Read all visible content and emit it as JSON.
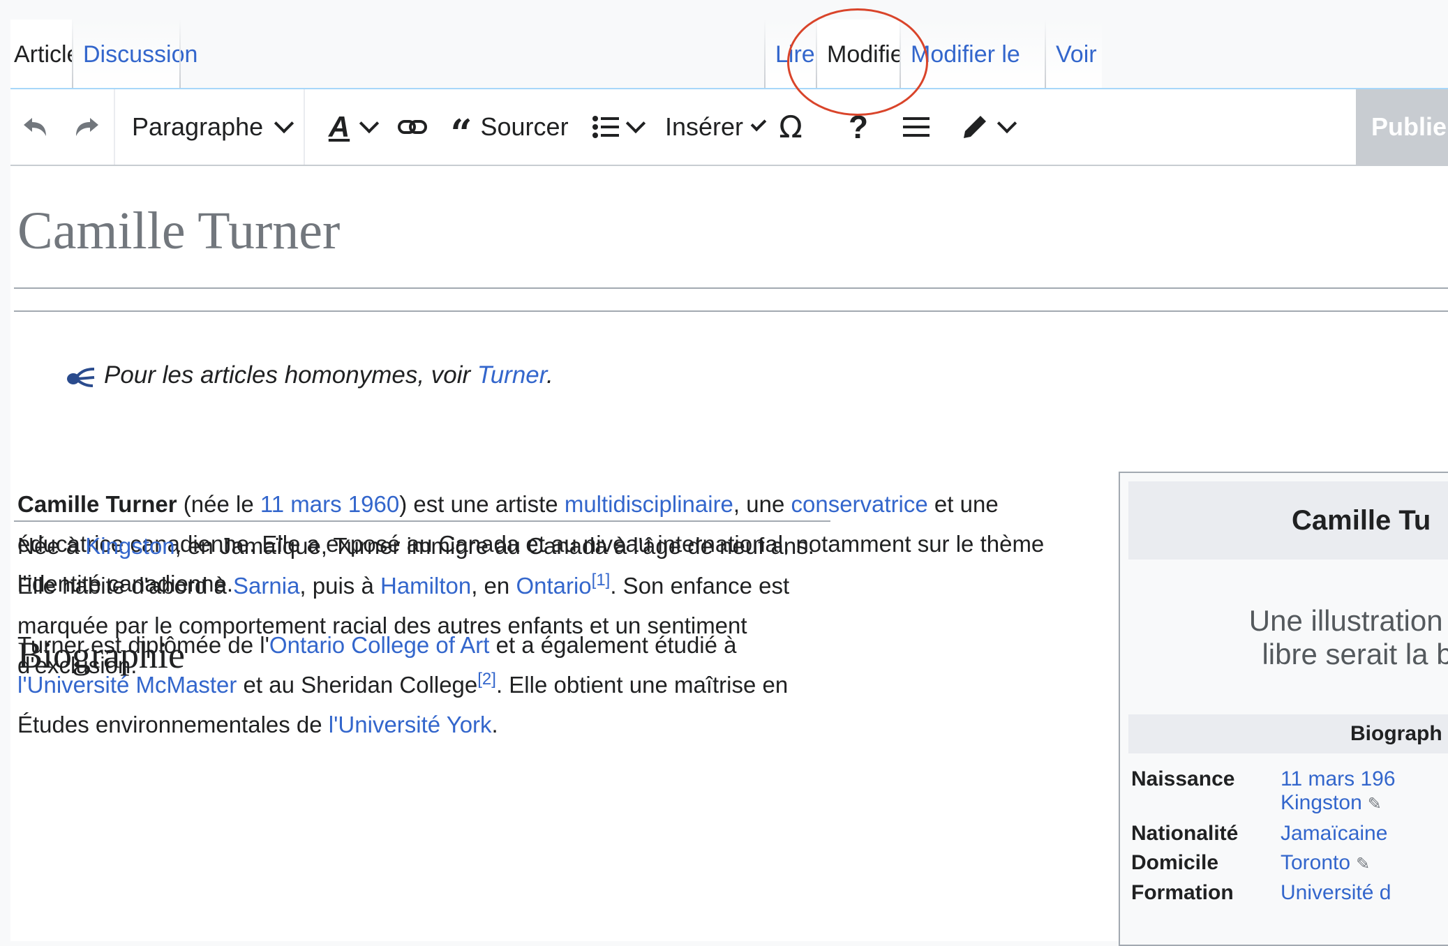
{
  "tabs": {
    "article": "Article",
    "discussion": "Discussion",
    "read": "Lire",
    "edit": "Modifier",
    "edit_source": "Modifier le code",
    "history": "Voir l"
  },
  "toolbar": {
    "paragraph": "Paragraphe",
    "cite": "Sourcer",
    "insert": "Insérer",
    "publish": "Publie"
  },
  "page": {
    "title": "Camille Turner",
    "hatnote": {
      "prefix": "Pour les articles homonymes, voir ",
      "link": "Turner",
      "suffix": "."
    },
    "intro": {
      "name": "Camille Turner",
      "t1": " (née le ",
      "date_link": "11 mars 1960",
      "t2": ") est une artiste ",
      "multi_link": "multidisciplinaire",
      "t3": ", une ",
      "curator_link": "conservatrice",
      "t4": " et une éducatrice canadienne. Elle a exposé au Canada et au niveau international, notamment sur le thème l'identité canadienne."
    },
    "biography_heading": "Biographie",
    "bio_p1": {
      "t1": "Née à ",
      "kingston": "Kingston",
      "t2": ", en Jamaïque, Turner immigre au Canada à l'âge de neuf ans. Elle habite d'abord à ",
      "sarnia": "Sarnia",
      "t3": ", puis à ",
      "hamilton": "Hamilton",
      "t4": ", en ",
      "ontario": "Ontario",
      "ref1": "[1]",
      "t5": ". Son enfance est marquée par le comportement racial des autres enfants et un sentiment d'exclusion."
    },
    "bio_p2": {
      "t1": "Turner est diplômée de l'",
      "oca": "Ontario College of Art",
      "t2": " et a également étudié à ",
      "mcmaster": "l'Université McMaster",
      "t3": " et au Sheridan College",
      "ref2": "[2]",
      "t4": ". Elle obtient une maîtrise en Études environnementales de ",
      "york1": "l'Université",
      "york2": "York",
      "t5": "."
    }
  },
  "infobox": {
    "title": "Camille Tu",
    "caption_line1": "Une illustration s",
    "caption_line2": "libre serait la b",
    "section": "Biograph",
    "rows": [
      {
        "label": "Naissance",
        "value": "11 mars 196",
        "value2": "Kingston"
      },
      {
        "label": "Nationalité",
        "value": "Jamaïcaine"
      },
      {
        "label": "Domicile",
        "value": "Toronto"
      },
      {
        "label": "Formation",
        "value": "Université d"
      }
    ]
  }
}
